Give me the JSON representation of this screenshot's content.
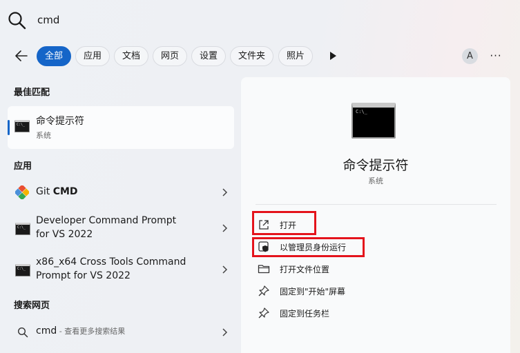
{
  "search": {
    "query": "cmd"
  },
  "tabs": [
    {
      "label": "全部",
      "active": true
    },
    {
      "label": "应用"
    },
    {
      "label": "文档"
    },
    {
      "label": "网页"
    },
    {
      "label": "设置"
    },
    {
      "label": "文件夹"
    },
    {
      "label": "照片"
    }
  ],
  "account": {
    "avatar_letter": "A"
  },
  "more_label": "···",
  "best_match": {
    "heading": "最佳匹配",
    "title": "命令提示符",
    "subtitle": "系统"
  },
  "apps": {
    "heading": "应用",
    "items": [
      {
        "title_prefix": "Git ",
        "title_bold": "CMD"
      },
      {
        "line1": "Developer Command Prompt",
        "line2": "for VS 2022"
      },
      {
        "line1": "x86_x64 Cross Tools Command",
        "line2": "Prompt for VS 2022"
      }
    ]
  },
  "web": {
    "heading": "搜索网页",
    "query": "cmd",
    "suffix": " - 查看更多搜索结果"
  },
  "detail": {
    "title": "命令提示符",
    "subtitle": "系统",
    "actions": [
      {
        "label": "打开",
        "icon": "open-external-icon"
      },
      {
        "label": "以管理员身份运行",
        "icon": "shield-icon"
      },
      {
        "label": "打开文件位置",
        "icon": "folder-icon"
      },
      {
        "label": "固定到\"开始\"屏幕",
        "icon": "pin-icon"
      },
      {
        "label": "固定到任务栏",
        "icon": "pin-icon"
      }
    ]
  },
  "colors": {
    "accent": "#1565c8",
    "highlight": "#e4131b"
  }
}
